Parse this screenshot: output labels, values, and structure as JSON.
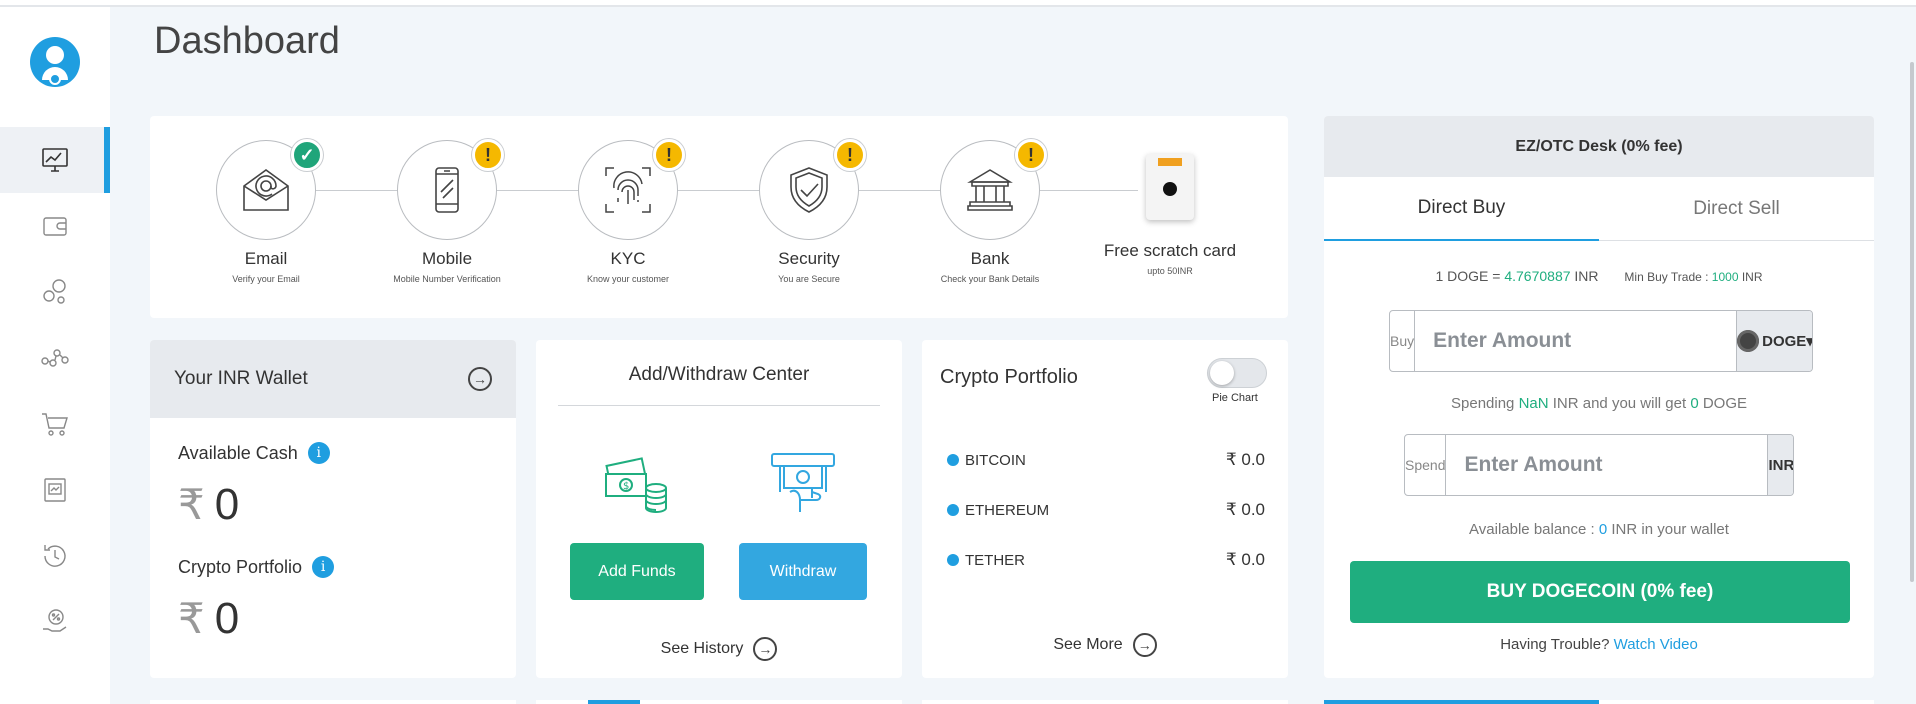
{
  "page": {
    "title": "Dashboard"
  },
  "sidebar": {
    "items": [
      {
        "id": "dashboard",
        "icon": "monitor-chart-icon",
        "active": true
      },
      {
        "id": "wallet",
        "icon": "wallet-icon"
      },
      {
        "id": "crypto",
        "icon": "coins-bubbles-icon"
      },
      {
        "id": "network",
        "icon": "network-nodes-icon"
      },
      {
        "id": "shop",
        "icon": "shopping-cart-icon"
      },
      {
        "id": "reports",
        "icon": "report-document-icon"
      },
      {
        "id": "history",
        "icon": "history-clock-icon"
      },
      {
        "id": "offers",
        "icon": "percent-hand-icon"
      }
    ]
  },
  "verification": {
    "steps": [
      {
        "name": "Email",
        "sub": "Verify your Email",
        "status": "ok",
        "badge": "✓"
      },
      {
        "name": "Mobile",
        "sub": "Mobile Number Verification",
        "status": "warn",
        "badge": "!"
      },
      {
        "name": "KYC",
        "sub": "Know your customer",
        "status": "warn",
        "badge": "!"
      },
      {
        "name": "Security",
        "sub": "You are Secure",
        "status": "warn",
        "badge": "!"
      },
      {
        "name": "Bank",
        "sub": "Check your Bank Details",
        "status": "warn",
        "badge": "!"
      }
    ],
    "scratch": {
      "name": "Free scratch card",
      "sub": "upto 50INR"
    }
  },
  "wallet": {
    "title": "Your INR Wallet",
    "cash_label": "Available Cash",
    "cash_symbol": "₹",
    "cash_value": "0",
    "portfolio_label": "Crypto Portfolio",
    "portfolio_symbol": "₹",
    "portfolio_value": "0",
    "info": "i",
    "arrow": "→"
  },
  "add_withdraw": {
    "title": "Add/Withdraw Center",
    "add_label": "Add Funds",
    "withdraw_label": "Withdraw",
    "history_label": "See History",
    "arrow": "→"
  },
  "portfolio": {
    "title": "Crypto Portfolio",
    "toggle_label": "Pie Chart",
    "rows": [
      {
        "coin": "BITCOIN",
        "value": "₹  0.0"
      },
      {
        "coin": "ETHEREUM",
        "value": "₹  0.0"
      },
      {
        "coin": "TETHER",
        "value": "₹  0.0"
      }
    ],
    "more_label": "See More",
    "arrow": "→"
  },
  "otc": {
    "title": "EZ/OTC Desk (0% fee)",
    "tabs": [
      "Direct Buy",
      "Direct Sell"
    ],
    "rate_prefix": "1 DOGE = ",
    "rate_value": "4.7670887",
    "rate_unit": " INR",
    "min_label": "Min Buy Trade : ",
    "min_value": "1000",
    "min_unit": " INR",
    "buy_label": "Buy",
    "buy_placeholder": "Enter Amount",
    "buy_currency": "DOGE▾",
    "spending_prefix": "Spending ",
    "spending_value": "NaN",
    "spending_mid": " INR and you will get ",
    "spending_get": "0",
    "spending_unit": " DOGE",
    "spend_label": "Spend",
    "spend_placeholder": "Enter Amount",
    "spend_currency": "INR",
    "chevron": "⌄",
    "balance_prefix": "Available balance : ",
    "balance_value": "0",
    "balance_suffix": " INR in your wallet",
    "buy_button": "BUY DOGECOIN (0% fee)",
    "trouble_prefix": "Having Trouble? ",
    "trouble_link": "Watch Video"
  },
  "colors": {
    "accent": "#1f9ee0",
    "green": "#1fae7f",
    "warning": "#f5b800"
  }
}
